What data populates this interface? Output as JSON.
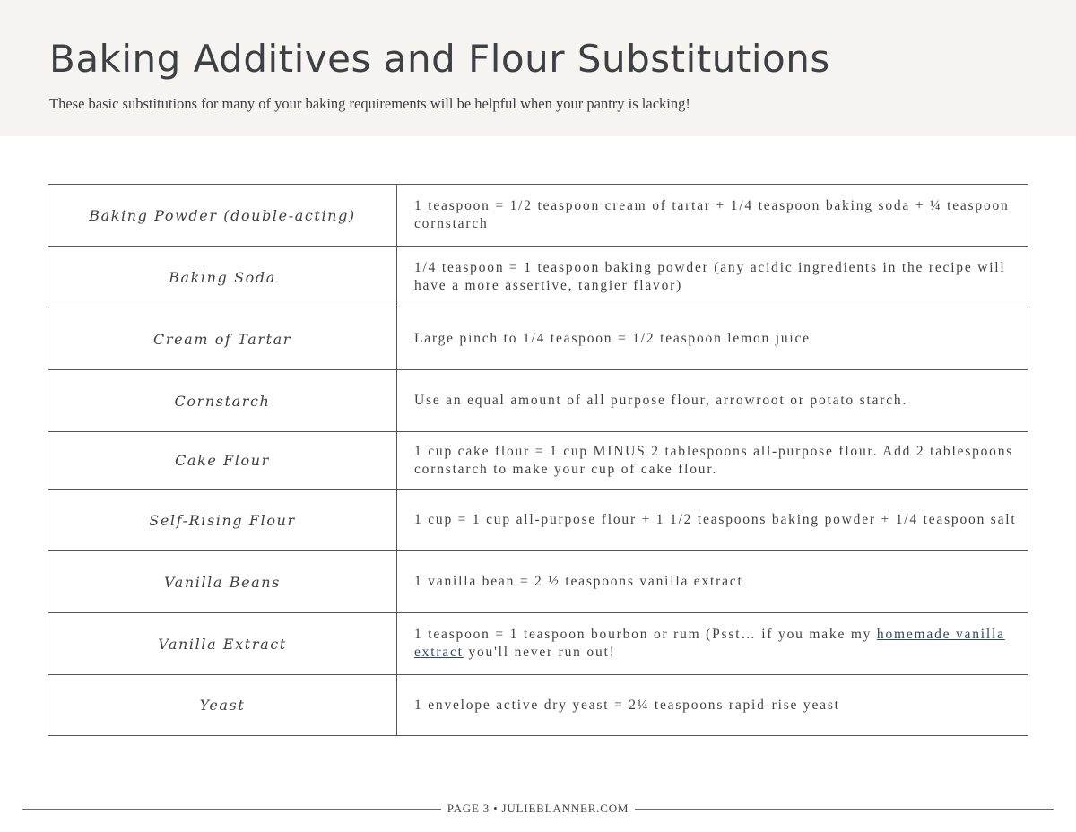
{
  "header": {
    "title": "Baking Additives and Flour Substitutions",
    "subtitle": "These basic substitutions for many of your baking requirements will be helpful when your pantry is lacking!"
  },
  "table": {
    "rows": [
      {
        "ingredient": "Baking Powder (double-acting)",
        "substitution": "1 teaspoon = 1/2 teaspoon cream of tartar + 1/4 teaspoon baking soda + ¼ teaspoon cornstarch"
      },
      {
        "ingredient": "Baking Soda",
        "substitution": "1/4 teaspoon = 1 teaspoon baking powder (any acidic ingredients in the recipe will have a more assertive, tangier flavor)"
      },
      {
        "ingredient": "Cream of Tartar",
        "substitution": "Large pinch to 1/4 teaspoon = 1/2 teaspoon lemon juice"
      },
      {
        "ingredient": "Cornstarch",
        "substitution": "Use an equal amount of all purpose flour, arrowroot or potato starch."
      },
      {
        "ingredient": "Cake Flour",
        "substitution": "1 cup cake flour = 1 cup MINUS 2 tablespoons all-purpose flour. Add 2 tablespoons cornstarch to make your cup of cake flour."
      },
      {
        "ingredient": "Self-Rising Flour",
        "substitution": "1 cup = 1 cup all-purpose flour + 1 1/2 teaspoons baking powder + 1/4 teaspoon salt"
      },
      {
        "ingredient": "Vanilla Beans",
        "substitution": "1 vanilla bean = 2 ½ teaspoons vanilla extract"
      },
      {
        "ingredient": "Vanilla Extract",
        "substitution_before": "1 teaspoon = 1 teaspoon bourbon or rum (Psst… if you make my ",
        "link_text": "homemade vanilla extract",
        "substitution_after": " you'll never run out!"
      },
      {
        "ingredient": "Yeast",
        "substitution": "1 envelope active dry yeast = 2¼ teaspoons rapid-rise yeast"
      }
    ]
  },
  "colors": {
    "header_bg": "#f5f4f1",
    "text": "#3f3f42",
    "link": "#2b4660",
    "border": "#555557"
  },
  "footer": {
    "label": "PAGE 3 • JULIEBLANNER.COM"
  }
}
